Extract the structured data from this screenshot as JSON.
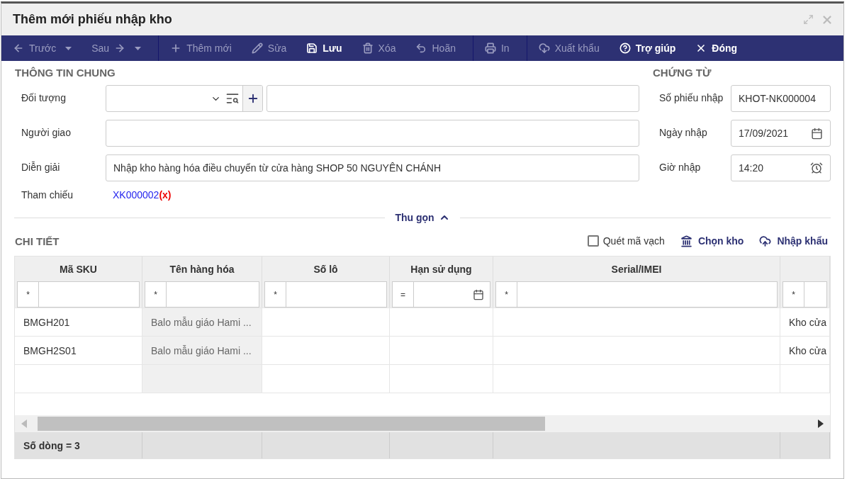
{
  "window": {
    "title": "Thêm mới phiếu nhập kho"
  },
  "toolbar": {
    "groups": [
      [
        {
          "label": "Trước",
          "disabled": true,
          "dropdown": true
        },
        {
          "label": "Sau",
          "disabled": true,
          "dropdown": true
        }
      ],
      [
        {
          "label": "Thêm mới",
          "disabled": true
        },
        {
          "label": "Sửa",
          "disabled": true
        },
        {
          "label": "Lưu",
          "disabled": false
        },
        {
          "label": "Xóa",
          "disabled": true
        },
        {
          "label": "Hoãn",
          "disabled": true
        }
      ],
      [
        {
          "label": "In",
          "disabled": true
        }
      ],
      [
        {
          "label": "Xuất khẩu",
          "disabled": true
        },
        {
          "label": "Trợ giúp",
          "disabled": false
        },
        {
          "label": "Đóng",
          "disabled": false
        }
      ]
    ]
  },
  "general": {
    "title": "THÔNG TIN CHUNG",
    "fields": [
      {
        "kind": "lookup",
        "label": "Đối tượng"
      },
      {
        "kind": "text",
        "label": "Người giao"
      },
      {
        "kind": "text",
        "label": "Diễn giải",
        "value": "Nhập kho hàng hóa điều chuyển từ cửa hàng SHOP 50 NGUYÊN CHÁNH"
      },
      {
        "kind": "reference",
        "label": "Tham chiếu",
        "link": "XK000002",
        "remove": "(x)"
      }
    ]
  },
  "document": {
    "title": "CHỨNG TỪ",
    "fields": [
      {
        "kind": "text",
        "label": "Số phiếu nhập",
        "value": "KHOT-NK000004"
      },
      {
        "kind": "date",
        "label": "Ngày nhập",
        "value": "17/09/2021"
      },
      {
        "kind": "time",
        "label": "Giờ nhập",
        "value": "14:20"
      }
    ]
  },
  "collapse": {
    "label": "Thu gọn",
    "expanded": true
  },
  "detail": {
    "title": "CHI TIẾT",
    "actions": [
      {
        "kind": "checkbox",
        "label": "Quét mã vạch",
        "checked": false
      },
      {
        "kind": "link",
        "label": "Chọn kho"
      },
      {
        "kind": "link",
        "label": "Nhập khẩu"
      }
    ]
  },
  "table": {
    "columns": [
      {
        "label": "Mã SKU",
        "filter": "*",
        "readonly": false
      },
      {
        "label": "Tên hàng hóa",
        "filter": "*",
        "readonly": true
      },
      {
        "label": "Số lô",
        "filter": "*",
        "readonly": false
      },
      {
        "label": "Hạn sử dụng",
        "filter": "=",
        "kind": "date",
        "readonly": false
      },
      {
        "label": "Serial/IMEI",
        "filter": "*",
        "readonly": false
      },
      {
        "filter": "*",
        "readonly": false
      }
    ],
    "rows": [
      {
        "cells": [
          "BMGH201",
          "Balo mẫu giáo Hami ...",
          null,
          null,
          null,
          "Kho cửa"
        ]
      },
      {
        "cells": [
          "BMGH2S01",
          "Balo mẫu giáo Hami ...",
          null,
          null,
          null,
          "Kho cửa"
        ]
      },
      {
        "cells": [
          null,
          null,
          null,
          null,
          null,
          null
        ]
      }
    ],
    "footer": "Số dòng = 3"
  }
}
